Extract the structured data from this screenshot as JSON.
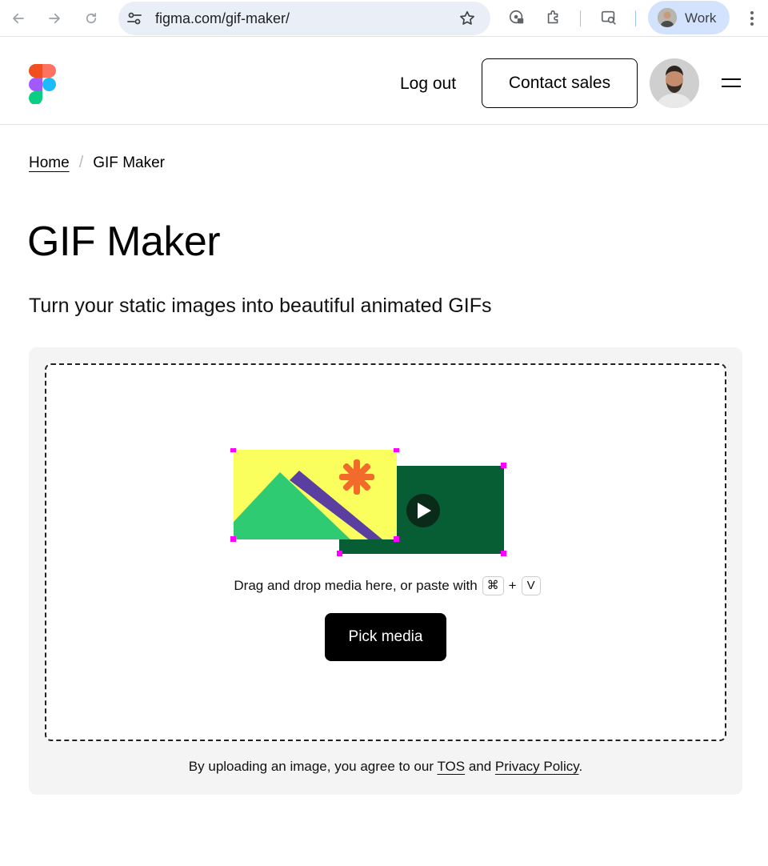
{
  "browser": {
    "url": "figma.com/gif-maker/",
    "profile_label": "Work",
    "icons": [
      "back-arrow-icon",
      "forward-arrow-icon",
      "reload-icon",
      "site-info-icon",
      "bookmark-star-icon",
      "password-manager-icon",
      "extensions-icon",
      "lens-search-icon",
      "menu-kebab-icon"
    ]
  },
  "header": {
    "logout_label": "Log out",
    "contact_label": "Contact sales"
  },
  "breadcrumb": {
    "home": "Home",
    "separator": "/",
    "current": "GIF Maker"
  },
  "page": {
    "title": "GIF Maker",
    "subtitle": "Turn your static images into beautiful animated GIFs"
  },
  "upload": {
    "hint_text": "Drag and drop media here, or paste with",
    "key_cmd": "⌘",
    "key_plus": "+",
    "key_v": "V",
    "pick_label": "Pick media"
  },
  "legal": {
    "prefix": "By uploading an image, you agree to our",
    "tos": "TOS",
    "and": "and",
    "privacy": "Privacy Policy",
    "suffix": "."
  },
  "colors": {
    "accent_yellow": "#fbff5e",
    "mountain_green": "#2ecb73",
    "mountain_purple": "#5b3fa0",
    "sun_orange": "#f26b2a",
    "video_green": "#075e35",
    "handle_magenta": "#ff00ff"
  }
}
